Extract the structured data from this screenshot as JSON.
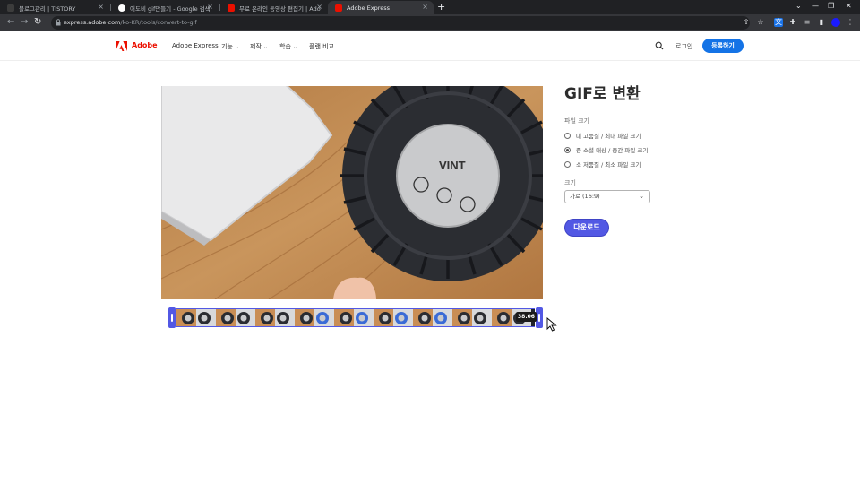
{
  "browser": {
    "tabs": [
      {
        "label": "블로그관리 | TISTORY",
        "active": false,
        "favicon_color": "#3c3c3c"
      },
      {
        "label": "어도비 gif만들기 - Google 검색",
        "active": false,
        "favicon_color": "#ffffff"
      },
      {
        "label": "무료 온라인 동영상 편집기 | Ado",
        "active": false,
        "favicon_color": "#eb1000"
      },
      {
        "label": "Adobe Express",
        "active": true,
        "favicon_color": "#eb1000"
      }
    ],
    "new_tab_icon": "plus-icon",
    "url_host": "express.adobe.com",
    "url_path": "/ko-KR/tools/convert-to-gif"
  },
  "header": {
    "brand": "Adobe",
    "nav": [
      {
        "label": "Adobe Express",
        "caret": false
      },
      {
        "label": "기능",
        "caret": true
      },
      {
        "label": "제작",
        "caret": true
      },
      {
        "label": "학습",
        "caret": true
      },
      {
        "label": "플랜 비교",
        "caret": false
      }
    ],
    "login": "로그인",
    "signup": "등록하기",
    "accent": "#1473e6"
  },
  "timeline": {
    "duration": "38.06",
    "frame_count": 18,
    "accent": "#5258e4"
  },
  "panel": {
    "title": "GIF로 변환",
    "filesize_label": "파일 크기",
    "filesize_options": [
      {
        "label": "대  고품질 / 최대 파일 크기",
        "checked": false
      },
      {
        "label": "중  소셜 대상 / 중간 파일 크기",
        "checked": true
      },
      {
        "label": "소  저품질 / 최소 파일 크기",
        "checked": false
      }
    ],
    "size_label": "크기",
    "size_value": "가로 (16:9)",
    "download": "다운로드",
    "download_color": "#5258e4"
  }
}
